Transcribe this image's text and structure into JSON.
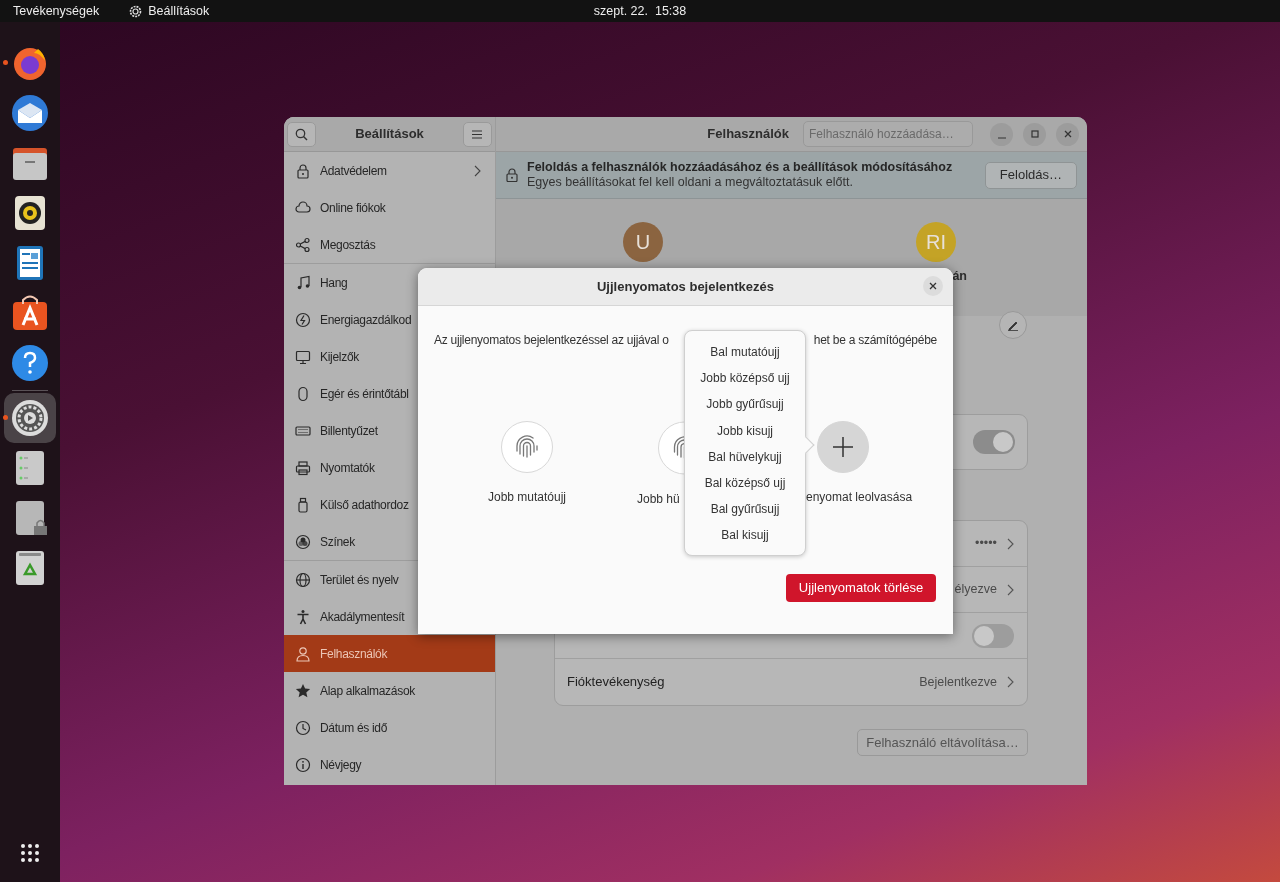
{
  "topbar": {
    "activities": "Tevékenységek",
    "app": "Beállítások",
    "clock": "szept. 22.  15:38"
  },
  "dock": {
    "favorites": [
      {
        "running": true,
        "selected": false
      },
      {
        "running": false,
        "selected": false
      },
      {
        "running": false,
        "selected": false
      },
      {
        "running": false,
        "selected": false
      },
      {
        "running": false,
        "selected": false
      },
      {
        "running": false,
        "selected": false
      },
      {
        "running": false,
        "selected": false
      }
    ],
    "others": [
      {
        "running": true,
        "selected": true
      },
      {
        "running": false,
        "selected": false
      },
      {
        "running": false,
        "selected": false
      },
      {
        "running": false,
        "selected": false
      }
    ]
  },
  "window": {
    "sidebar": {
      "title": "Beállítások",
      "groups": [
        [
          {
            "label": "Adatvédelem",
            "submenu": true,
            "selected": false
          },
          {
            "label": "Online fiókok",
            "submenu": false,
            "selected": false
          },
          {
            "label": "Megosztás",
            "submenu": false,
            "selected": false
          }
        ],
        [
          {
            "label": "Hang",
            "selected": false
          },
          {
            "label": "Energiagazdálkod",
            "selected": false
          },
          {
            "label": "Kijelzők",
            "selected": false
          },
          {
            "label": "Egér és érintőtábl",
            "selected": false
          },
          {
            "label": "Billentyűzet",
            "selected": false
          },
          {
            "label": "Nyomtatók",
            "selected": false
          },
          {
            "label": "Külső adathordoz",
            "selected": false
          },
          {
            "label": "Színek",
            "selected": false
          }
        ],
        [
          {
            "label": "Terület és nyelv",
            "selected": false
          },
          {
            "label": "Akadálymentesít",
            "selected": false
          },
          {
            "label": "Felhasználók",
            "submenu": false,
            "selected": true
          },
          {
            "label": "Alap alkalmazások",
            "submenu": false,
            "selected": false
          },
          {
            "label": "Dátum és idő",
            "submenu": false,
            "selected": false
          },
          {
            "label": "Névjegy",
            "submenu": false,
            "selected": false
          }
        ]
      ]
    },
    "title": "Felhasználók",
    "add_user": {
      "placeholder": "Felhasználó hozzáadása…"
    },
    "banner": {
      "title": "Feloldás a felhasználók hozzáadásához és a beállítások módosításához",
      "subtitle": "Egyes beállításokat fel kell oldani a megváltoztatásuk előtt.",
      "button": "Feloldás…"
    },
    "users": [
      {
        "initials": "U",
        "color": "#8b6440"
      },
      {
        "initials": "RI",
        "color": "#c4a326",
        "name": "án"
      }
    ],
    "admin_toggle": {
      "on": true
    },
    "account_rows": [
      {
        "kind": "link",
        "value": "•••••"
      },
      {
        "kind": "link",
        "value": "élyezve"
      },
      {
        "kind": "toggle",
        "on": false
      },
      {
        "kind": "link",
        "label": "Fióktevékenység",
        "value": "Bejelentkezve"
      }
    ],
    "remove_button": "Felhasználó eltávolítása…"
  },
  "dialog": {
    "title": "Ujjlenyomatos bejelentkezés",
    "description_left": "Az ujjlenyomatos bejelentkezéssel az ujjával o",
    "description_right": "het be a számítógépébe",
    "fingers": [
      {
        "kind": "enrolled",
        "label": "Jobb mutatóujj"
      },
      {
        "kind": "enrolled",
        "label": "Jobb hü"
      },
      {
        "kind": "add",
        "label": "enyomat leolvasása"
      }
    ],
    "menu": [
      "Bal mutatóujj",
      "Jobb középső ujj",
      "Jobb gyűrűsujj",
      "Jobb kisujj",
      "Bal hüvelykujj",
      "Bal középső ujj",
      "Bal gyűrűsujj",
      "Bal kisujj"
    ],
    "delete_button": "Ujjlenyomatok törlése"
  }
}
